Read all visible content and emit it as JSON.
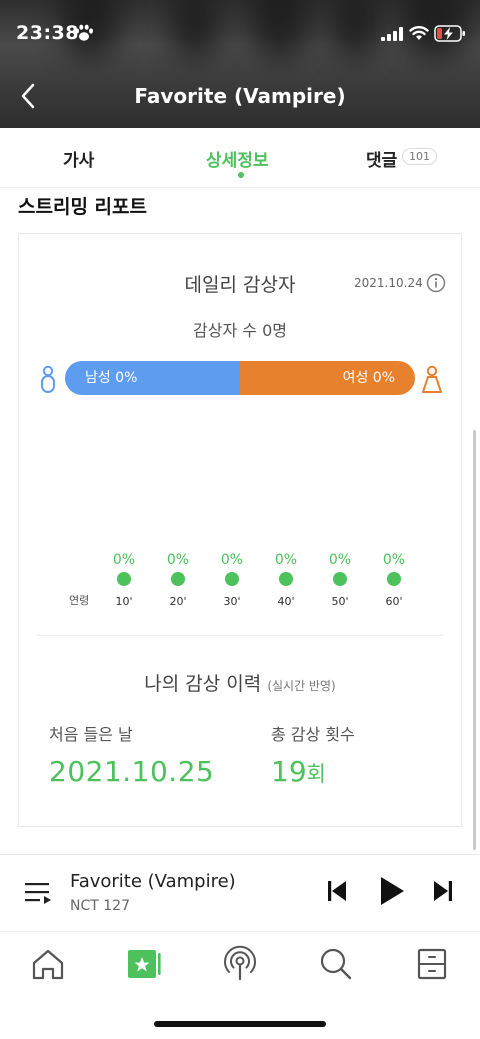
{
  "status_bar": {
    "time": "23:38"
  },
  "header": {
    "title": "Favorite (Vampire)"
  },
  "tabs": [
    {
      "label": "가사"
    },
    {
      "label": "상세정보",
      "active": true
    },
    {
      "label": "댓글",
      "badge": "101"
    }
  ],
  "section": {
    "title": "스트리밍 리포트"
  },
  "daily": {
    "title": "데일리 감상자",
    "date": "2021.10.24",
    "listeners": "감상자 수 0명",
    "male_label": "남성 0%",
    "female_label": "여성 0%",
    "male_share": 0.5,
    "female_share": 0.5
  },
  "ages": {
    "label": "연령",
    "items": [
      {
        "pct": "0%",
        "age": "10'"
      },
      {
        "pct": "0%",
        "age": "20'"
      },
      {
        "pct": "0%",
        "age": "30'"
      },
      {
        "pct": "0%",
        "age": "40'"
      },
      {
        "pct": "0%",
        "age": "50'"
      },
      {
        "pct": "0%",
        "age": "60'"
      }
    ]
  },
  "history": {
    "title": "나의 감상 이력",
    "subtitle": "(실시간 반영)",
    "first_listened_label": "처음 들은 날",
    "first_listened_value": "2021.10.25",
    "total_label": "총 감상 횟수",
    "total_value": "19",
    "total_unit": "회"
  },
  "player": {
    "song": "Favorite (Vampire)",
    "artist": "NCT 127"
  },
  "colors": {
    "accent": "#4cc15c",
    "male": "#5e9cf0",
    "female": "#e8812d"
  },
  "nav_icons": [
    "home-icon",
    "my-music-icon",
    "podcast-icon",
    "search-icon",
    "menu-drawer-icon"
  ]
}
